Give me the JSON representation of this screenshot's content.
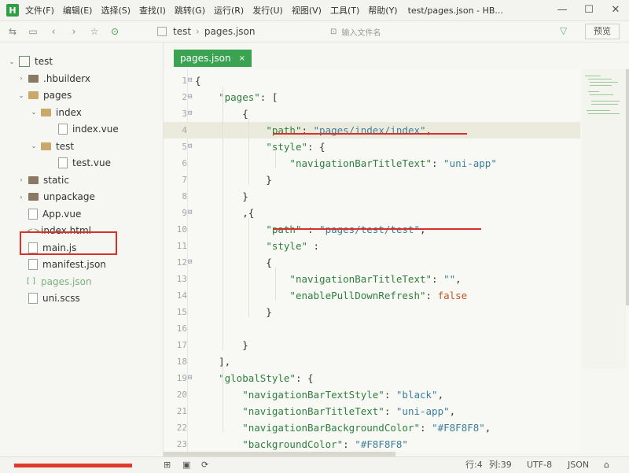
{
  "title_bar": {
    "logo": "H",
    "menu": [
      "文件(F)",
      "编辑(E)",
      "选择(S)",
      "查找(I)",
      "跳转(G)",
      "运行(R)",
      "发行(U)",
      "视图(V)",
      "工具(T)",
      "帮助(Y)"
    ],
    "title": "test/pages.json - HB...",
    "minimize": "—",
    "maximize": "☐",
    "close": "✕"
  },
  "toolbar": {
    "breadcrumb": [
      "test",
      "pages.json"
    ],
    "breadcrumb_sep": "›",
    "file_input_placeholder": "输入文件名",
    "preview_label": "预览"
  },
  "sidebar": {
    "items": [
      {
        "label": "test",
        "depth": 0,
        "arrow": "⌄",
        "kind": "project"
      },
      {
        "label": ".hbuilderx",
        "depth": 1,
        "arrow": "›",
        "kind": "folder"
      },
      {
        "label": "pages",
        "depth": 1,
        "arrow": "⌄",
        "kind": "folder-open"
      },
      {
        "label": "index",
        "depth": 2,
        "arrow": "⌄",
        "kind": "folder-open"
      },
      {
        "label": "index.vue",
        "depth": 3,
        "arrow": "",
        "kind": "file"
      },
      {
        "label": "test",
        "depth": 2,
        "arrow": "⌄",
        "kind": "folder-open"
      },
      {
        "label": "test.vue",
        "depth": 3,
        "arrow": "",
        "kind": "file"
      },
      {
        "label": "static",
        "depth": 1,
        "arrow": "›",
        "kind": "folder"
      },
      {
        "label": "unpackage",
        "depth": 1,
        "arrow": "›",
        "kind": "folder"
      },
      {
        "label": "App.vue",
        "depth": 1,
        "arrow": "",
        "kind": "file"
      },
      {
        "label": "index.html",
        "depth": 1,
        "arrow": "",
        "kind": "tag"
      },
      {
        "label": "main.js",
        "depth": 1,
        "arrow": "",
        "kind": "file"
      },
      {
        "label": "manifest.json",
        "depth": 1,
        "arrow": "",
        "kind": "file"
      },
      {
        "label": "pages.json",
        "depth": 1,
        "arrow": "",
        "kind": "json",
        "selected": true
      },
      {
        "label": "uni.scss",
        "depth": 1,
        "arrow": "",
        "kind": "file"
      }
    ]
  },
  "editor": {
    "tab": {
      "label": "pages.json",
      "close": "×"
    },
    "lines": [
      {
        "n": "1",
        "fold": "⊟",
        "tokens": [
          {
            "t": "p",
            "v": "{"
          }
        ]
      },
      {
        "n": "2",
        "fold": "⊟",
        "tokens": [
          {
            "t": "p",
            "v": "    "
          },
          {
            "t": "k",
            "v": "\"pages\""
          },
          {
            "t": "p",
            "v": ": ["
          }
        ]
      },
      {
        "n": "3",
        "fold": "⊟",
        "tokens": [
          {
            "t": "p",
            "v": "        {"
          }
        ]
      },
      {
        "n": "4",
        "fold": "",
        "tokens": [
          {
            "t": "p",
            "v": "            "
          },
          {
            "t": "k",
            "v": "\"path\""
          },
          {
            "t": "p",
            "v": ": "
          },
          {
            "t": "s",
            "v": "\"pages/index/index\""
          },
          {
            "t": "p",
            "v": ","
          }
        ],
        "active": true
      },
      {
        "n": "5",
        "fold": "⊟",
        "tokens": [
          {
            "t": "p",
            "v": "            "
          },
          {
            "t": "k",
            "v": "\"style\""
          },
          {
            "t": "p",
            "v": ": {"
          }
        ]
      },
      {
        "n": "6",
        "fold": "",
        "tokens": [
          {
            "t": "p",
            "v": "                "
          },
          {
            "t": "k",
            "v": "\"navigationBarTitleText\""
          },
          {
            "t": "p",
            "v": ": "
          },
          {
            "t": "s",
            "v": "\"uni-app\""
          }
        ]
      },
      {
        "n": "7",
        "fold": "",
        "tokens": [
          {
            "t": "p",
            "v": "            }"
          }
        ]
      },
      {
        "n": "8",
        "fold": "",
        "tokens": [
          {
            "t": "p",
            "v": "        }"
          }
        ]
      },
      {
        "n": "9",
        "fold": "⊟",
        "tokens": [
          {
            "t": "p",
            "v": "        ,{"
          }
        ]
      },
      {
        "n": "10",
        "fold": "",
        "tokens": [
          {
            "t": "p",
            "v": "            "
          },
          {
            "t": "k",
            "v": "\"path\""
          },
          {
            "t": "p",
            "v": " : "
          },
          {
            "t": "s",
            "v": "\"pages/test/test\""
          },
          {
            "t": "p",
            "v": ","
          }
        ]
      },
      {
        "n": "11",
        "fold": "",
        "tokens": [
          {
            "t": "p",
            "v": "            "
          },
          {
            "t": "k",
            "v": "\"style\""
          },
          {
            "t": "p",
            "v": " :"
          }
        ]
      },
      {
        "n": "12",
        "fold": "⊟",
        "tokens": [
          {
            "t": "p",
            "v": "            {"
          }
        ]
      },
      {
        "n": "13",
        "fold": "",
        "tokens": [
          {
            "t": "p",
            "v": "                "
          },
          {
            "t": "k",
            "v": "\"navigationBarTitleText\""
          },
          {
            "t": "p",
            "v": ": "
          },
          {
            "t": "s",
            "v": "\"\""
          },
          {
            "t": "p",
            "v": ","
          }
        ]
      },
      {
        "n": "14",
        "fold": "",
        "tokens": [
          {
            "t": "p",
            "v": "                "
          },
          {
            "t": "k",
            "v": "\"enablePullDownRefresh\""
          },
          {
            "t": "p",
            "v": ": "
          },
          {
            "t": "b",
            "v": "false"
          }
        ]
      },
      {
        "n": "15",
        "fold": "",
        "tokens": [
          {
            "t": "p",
            "v": "            }"
          }
        ]
      },
      {
        "n": "16",
        "fold": "",
        "tokens": [
          {
            "t": "p",
            "v": ""
          }
        ]
      },
      {
        "n": "17",
        "fold": "",
        "tokens": [
          {
            "t": "p",
            "v": "        }"
          }
        ]
      },
      {
        "n": "18",
        "fold": "",
        "tokens": [
          {
            "t": "p",
            "v": "    ],"
          }
        ]
      },
      {
        "n": "19",
        "fold": "⊟",
        "tokens": [
          {
            "t": "p",
            "v": "    "
          },
          {
            "t": "k",
            "v": "\"globalStyle\""
          },
          {
            "t": "p",
            "v": ": {"
          }
        ]
      },
      {
        "n": "20",
        "fold": "",
        "tokens": [
          {
            "t": "p",
            "v": "        "
          },
          {
            "t": "k",
            "v": "\"navigationBarTextStyle\""
          },
          {
            "t": "p",
            "v": ": "
          },
          {
            "t": "s",
            "v": "\"black\""
          },
          {
            "t": "p",
            "v": ","
          }
        ]
      },
      {
        "n": "21",
        "fold": "",
        "tokens": [
          {
            "t": "p",
            "v": "        "
          },
          {
            "t": "k",
            "v": "\"navigationBarTitleText\""
          },
          {
            "t": "p",
            "v": ": "
          },
          {
            "t": "s",
            "v": "\"uni-app\""
          },
          {
            "t": "p",
            "v": ","
          }
        ]
      },
      {
        "n": "22",
        "fold": "",
        "tokens": [
          {
            "t": "p",
            "v": "        "
          },
          {
            "t": "k",
            "v": "\"navigationBarBackgroundColor\""
          },
          {
            "t": "p",
            "v": ": "
          },
          {
            "t": "s",
            "v": "\"#F8F8F8\""
          },
          {
            "t": "p",
            "v": ","
          }
        ]
      },
      {
        "n": "23",
        "fold": "",
        "tokens": [
          {
            "t": "p",
            "v": "        "
          },
          {
            "t": "k",
            "v": "\"backgroundColor\""
          },
          {
            "t": "p",
            "v": ": "
          },
          {
            "t": "s",
            "v": "\"#F8F8F8\""
          }
        ]
      },
      {
        "n": "24",
        "fold": "",
        "tokens": [
          {
            "t": "p",
            "v": "    }"
          }
        ]
      }
    ]
  },
  "status_bar": {
    "position": "行:4",
    "column": "列:39",
    "encoding": "UTF-8",
    "language": "JSON"
  },
  "colors": {
    "accent": "#3aa352",
    "highlight_red": "#d9302a",
    "key": "#2f7f3f",
    "string": "#3b7f9b",
    "boolean": "#c0571f"
  }
}
